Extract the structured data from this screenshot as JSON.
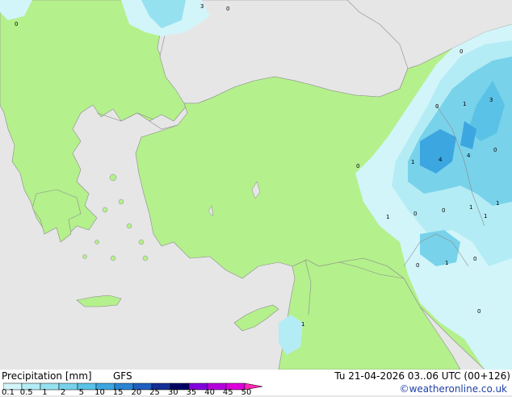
{
  "footer": {
    "title": "Precipitation [mm]",
    "model": "GFS",
    "valid_time": "Tu 21-04-2026 03..06 UTC (00+126)",
    "credit": "©weatheronline.co.uk"
  },
  "legend": {
    "ticks": [
      "0.1",
      "0.5",
      "1",
      "2",
      "5",
      "10",
      "15",
      "20",
      "25",
      "30",
      "35",
      "40",
      "45",
      "50"
    ],
    "colors": [
      "#d2f5fa",
      "#b4ecf5",
      "#96e1f0",
      "#78d2ea",
      "#5ac2e6",
      "#3ca6e0",
      "#2a84d2",
      "#1e5fc0",
      "#142e96",
      "#000064",
      "#8200dc",
      "#b400dc",
      "#dc00dc",
      "#ff28b4"
    ]
  },
  "map": {
    "colors": {
      "sea": "#e6e6e6",
      "land": "#b4f08c",
      "border": "#8c8c8c"
    },
    "value_labels": [
      "3",
      "0",
      "0",
      "0",
      "1",
      "3",
      "0",
      "1",
      "4",
      "4",
      "0",
      "0",
      "1",
      "0",
      "0",
      "1",
      "1",
      "1",
      "0",
      "1",
      "0",
      "0",
      "1"
    ]
  }
}
